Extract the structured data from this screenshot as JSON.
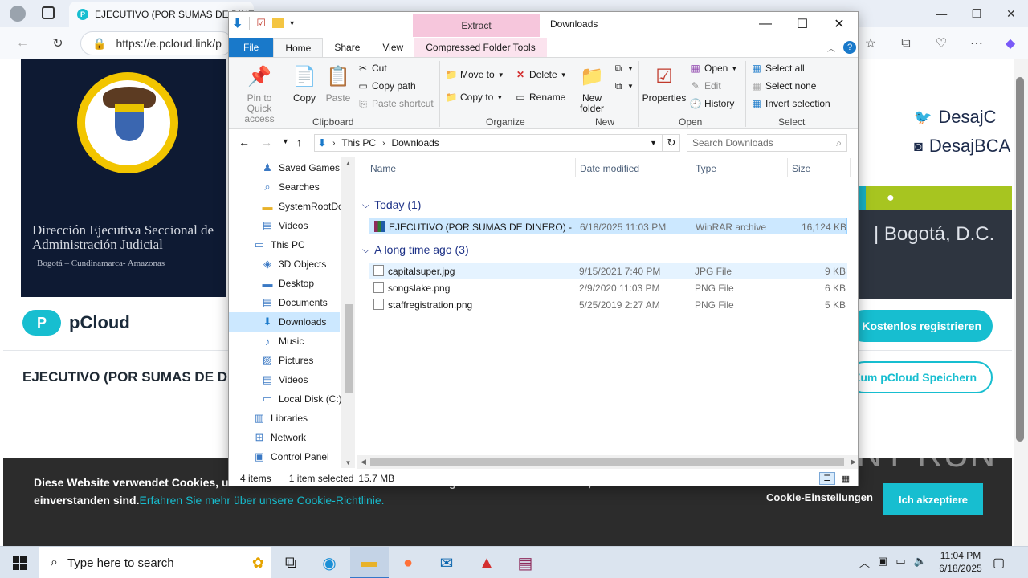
{
  "browser": {
    "tab_title": "EJECUTIVO (POR SUMAS DE DINERO) - pCloud",
    "url": "https://e.pcloud.link/p",
    "tab_favicon": "P"
  },
  "website": {
    "banner_title": "Dirección Ejecutiva Seccional de Administración Judicial",
    "banner_subtitle": "Bogotá – Cundinamarca- Amazonas",
    "social_twitter": "DesajC",
    "social_instagram": "DesajBCA",
    "city": "| Bogotá, D.C.",
    "logo_text": "pCloud",
    "logo_mark": "P",
    "page_title": "EJECUTIVO (POR SUMAS DE DINERO)",
    "register_button": "Kostenlos registrieren",
    "save_button": "Zum pCloud Speichern",
    "cookie_text": "Diese Website verwendet Cookies, um Informationen zu sammeln. Die Nutzung dieser Website bedeutet, dass Sie damit einverstanden sind.",
    "cookie_link": "Erfahren Sie mehr über unsere Cookie-Richtlinie.",
    "cookie_settings": "Cookie-Einstellungen",
    "cookie_accept": "Ich akzeptiere",
    "watermark": "ANY RUN"
  },
  "explorer": {
    "window_title": "Downloads",
    "contextual_tab": "Extract",
    "tabs": [
      "File",
      "Home",
      "Share",
      "View",
      "Compressed Folder Tools"
    ],
    "ribbon": {
      "pin": "Pin to Quick access",
      "copy": "Copy",
      "paste": "Paste",
      "cut": "Cut",
      "copy_path": "Copy path",
      "paste_shortcut": "Paste shortcut",
      "move_to": "Move to",
      "copy_to": "Copy to",
      "delete": "Delete",
      "rename": "Rename",
      "new_folder": "New folder",
      "properties": "Properties",
      "open": "Open",
      "edit": "Edit",
      "history": "History",
      "select_all": "Select all",
      "select_none": "Select none",
      "invert_selection": "Invert selection",
      "groups": [
        "Clipboard",
        "Organize",
        "New",
        "Open",
        "Select"
      ]
    },
    "breadcrumb": [
      "This PC",
      "Downloads"
    ],
    "search_placeholder": "Search Downloads",
    "nav_items": [
      {
        "label": "Saved Games",
        "icon": "saved-games-icon"
      },
      {
        "label": "Searches",
        "icon": "search-icon"
      },
      {
        "label": "SystemRootDo",
        "icon": "folder-icon"
      },
      {
        "label": "Videos",
        "icon": "videos-icon"
      },
      {
        "label": "This PC",
        "icon": "computer-icon"
      },
      {
        "label": "3D Objects",
        "icon": "3d-objects-icon"
      },
      {
        "label": "Desktop",
        "icon": "desktop-icon"
      },
      {
        "label": "Documents",
        "icon": "documents-icon"
      },
      {
        "label": "Downloads",
        "icon": "downloads-icon"
      },
      {
        "label": "Music",
        "icon": "music-icon"
      },
      {
        "label": "Pictures",
        "icon": "pictures-icon"
      },
      {
        "label": "Videos",
        "icon": "videos-icon"
      },
      {
        "label": "Local Disk (C:)",
        "icon": "disk-icon"
      },
      {
        "label": "Libraries",
        "icon": "libraries-icon"
      },
      {
        "label": "Network",
        "icon": "network-icon"
      },
      {
        "label": "Control Panel",
        "icon": "control-panel-icon"
      }
    ],
    "columns": [
      "Name",
      "Date modified",
      "Type",
      "Size"
    ],
    "groups": [
      {
        "label": "Today (1)",
        "files": [
          {
            "name": "EJECUTIVO (POR SUMAS DE DINERO) - R...",
            "date": "6/18/2025 11:03 PM",
            "type": "WinRAR archive",
            "size": "16,124 KB"
          }
        ]
      },
      {
        "label": "A long time ago (3)",
        "files": [
          {
            "name": "capitalsuper.jpg",
            "date": "9/15/2021 7:40 PM",
            "type": "JPG File",
            "size": "9 KB"
          },
          {
            "name": "songslake.png",
            "date": "2/9/2020 11:03 PM",
            "type": "PNG File",
            "size": "6 KB"
          },
          {
            "name": "staffregistration.png",
            "date": "5/25/2019 2:27 AM",
            "type": "PNG File",
            "size": "5 KB"
          }
        ]
      }
    ],
    "status": {
      "count": "4 items",
      "selected": "1 item selected",
      "size": "15.7 MB"
    }
  },
  "taskbar": {
    "search_placeholder": "Type here to search",
    "time": "11:04 PM",
    "date": "6/18/2025"
  },
  "colors": {
    "accent": "#1979ca",
    "pcloud": "#17bed0",
    "selection": "#cce8ff",
    "extract_tab": "#f6c6dc"
  }
}
